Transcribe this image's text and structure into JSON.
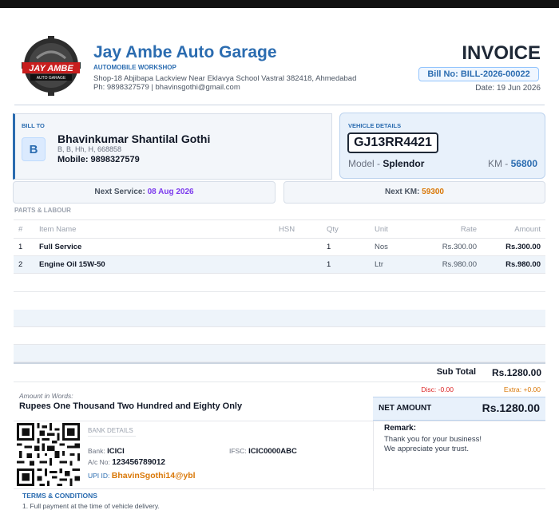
{
  "header": {
    "company": "Jay Ambe Auto Garage",
    "tagline": "AUTOMOBILE WORKSHOP",
    "address": "Shop-18 Abjibapa Lackview Near Eklavya School Vastral 382418, Ahmedabad",
    "contact": "Ph: 9898327579  |  bhavinsgothi@gmail.com",
    "logo_text_top": "JAY AMBE",
    "logo_text_bottom": "AUTO GARAGE",
    "doc_title": "INVOICE",
    "bill_no": "Bill No: BILL-2026-00022",
    "date": "Date: 19 Jun 2026"
  },
  "bill_to": {
    "label": "BILL TO",
    "initial": "B",
    "name": "Bhavinkumar Shantilal Gothi",
    "address": "B, B, Hh, H, 668858",
    "mobile": "Mobile: 9898327579"
  },
  "vehicle": {
    "label": "VEHICLE DETAILS",
    "plate": "GJ13RR4421",
    "model_label": "Model - ",
    "model": "Splendor",
    "km_label": "KM - ",
    "km": "56800"
  },
  "next": {
    "service_label": "Next Service: ",
    "service": "08 Aug 2026",
    "km_label": "Next KM: ",
    "km": "59300"
  },
  "parts": {
    "section": "PARTS & LABOUR",
    "columns": [
      "#",
      "Item Name",
      "HSN",
      "Qty",
      "Unit",
      "Rate",
      "Amount"
    ],
    "rows": [
      [
        "1",
        "Full Service",
        "",
        "1",
        "Nos",
        "Rs.300.00",
        "Rs.300.00"
      ],
      [
        "2",
        "Engine Oil 15W-50",
        "",
        "1",
        "Ltr",
        "Rs.980.00",
        "Rs.980.00"
      ]
    ]
  },
  "totals": {
    "subtotal_label": "Sub Total",
    "subtotal": "Rs.1280.00",
    "disc": "Disc: -0.00",
    "extra": "Extra: +0.00",
    "words_label": "Amount in Words:",
    "words": "Rupees One Thousand Two Hundred and Eighty Only",
    "net_label": "NET AMOUNT",
    "net": "Rs.1280.00"
  },
  "bank": {
    "label": "BANK DETAILS",
    "bank_label": "Bank: ",
    "bank": "ICICI",
    "ifsc_label": "IFSC: ",
    "ifsc": "ICIC0000ABC",
    "ac_label": "A/c No: ",
    "ac": "123456789012",
    "upi_label": "UPI ID: ",
    "upi": "BhavinSgothi14@ybl"
  },
  "remark": {
    "label": "Remark:",
    "line1": "Thank you for your business!",
    "line2": "We appreciate your trust."
  },
  "terms": {
    "label": "TERMS & CONDITIONS",
    "line1": "1. Full payment at the time of vehicle delivery."
  },
  "colors": {
    "accent": "#2b6cb0",
    "service": "#7c3aed",
    "km": "#d97706"
  }
}
